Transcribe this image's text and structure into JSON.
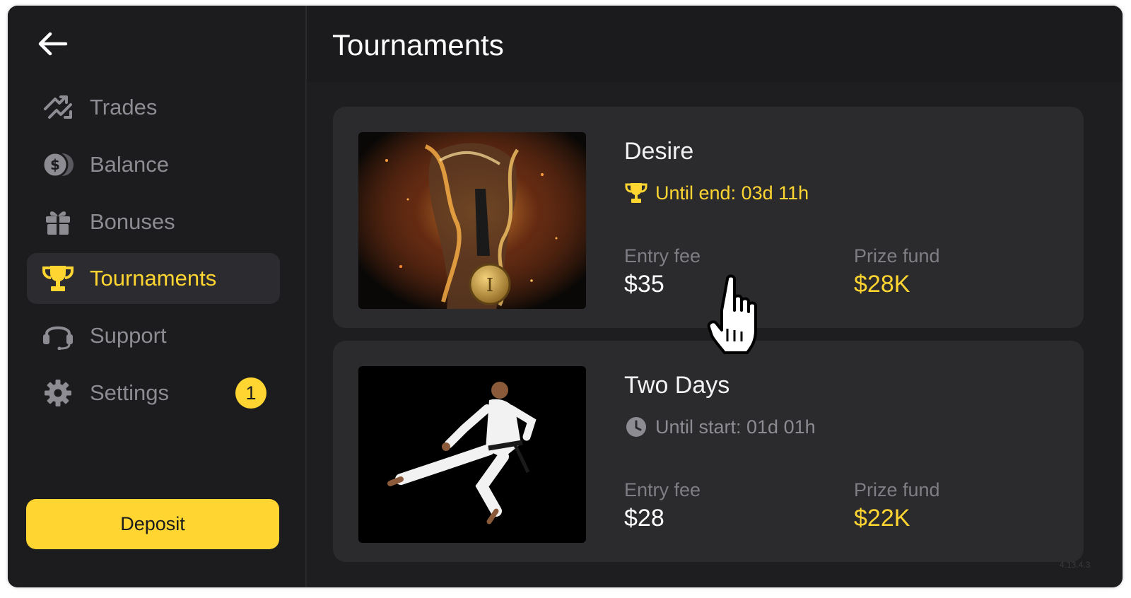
{
  "sidebar": {
    "back_icon": "arrow-left-icon",
    "items": [
      {
        "label": "Trades",
        "icon": "trades-arrows-icon",
        "active": false
      },
      {
        "label": "Balance",
        "icon": "coins-dollar-icon",
        "active": false
      },
      {
        "label": "Bonuses",
        "icon": "gift-icon",
        "active": false
      },
      {
        "label": "Tournaments",
        "icon": "trophy-icon",
        "active": true
      },
      {
        "label": "Support",
        "icon": "headset-icon",
        "active": false
      },
      {
        "label": "Settings",
        "icon": "gear-icon",
        "active": false,
        "badge": "1"
      }
    ],
    "deposit_label": "Deposit"
  },
  "main": {
    "title": "Tournaments",
    "tournaments": [
      {
        "name": "Desire",
        "status_icon": "trophy-icon",
        "status": "Until end: 03d 11h",
        "entry_fee_label": "Entry fee",
        "entry_fee": "$35",
        "prize_fund_label": "Prize fund",
        "prize_fund": "$28K",
        "image": "flaming-fist-with-medal-image"
      },
      {
        "name": "Two Days",
        "status_icon": "clock-icon",
        "status": "Until start: 01d 01h",
        "entry_fee_label": "Entry fee",
        "entry_fee": "$28",
        "prize_fund_label": "Prize fund",
        "prize_fund": "$22K",
        "image": "martial-artist-kick-image"
      }
    ]
  },
  "version": "4.13.4.3",
  "colors": {
    "accent": "#fed531",
    "background": "#1b1b1d",
    "card": "#2b2b2e",
    "muted_text": "#8c8c92"
  },
  "cursor": "hand-pointer-icon"
}
